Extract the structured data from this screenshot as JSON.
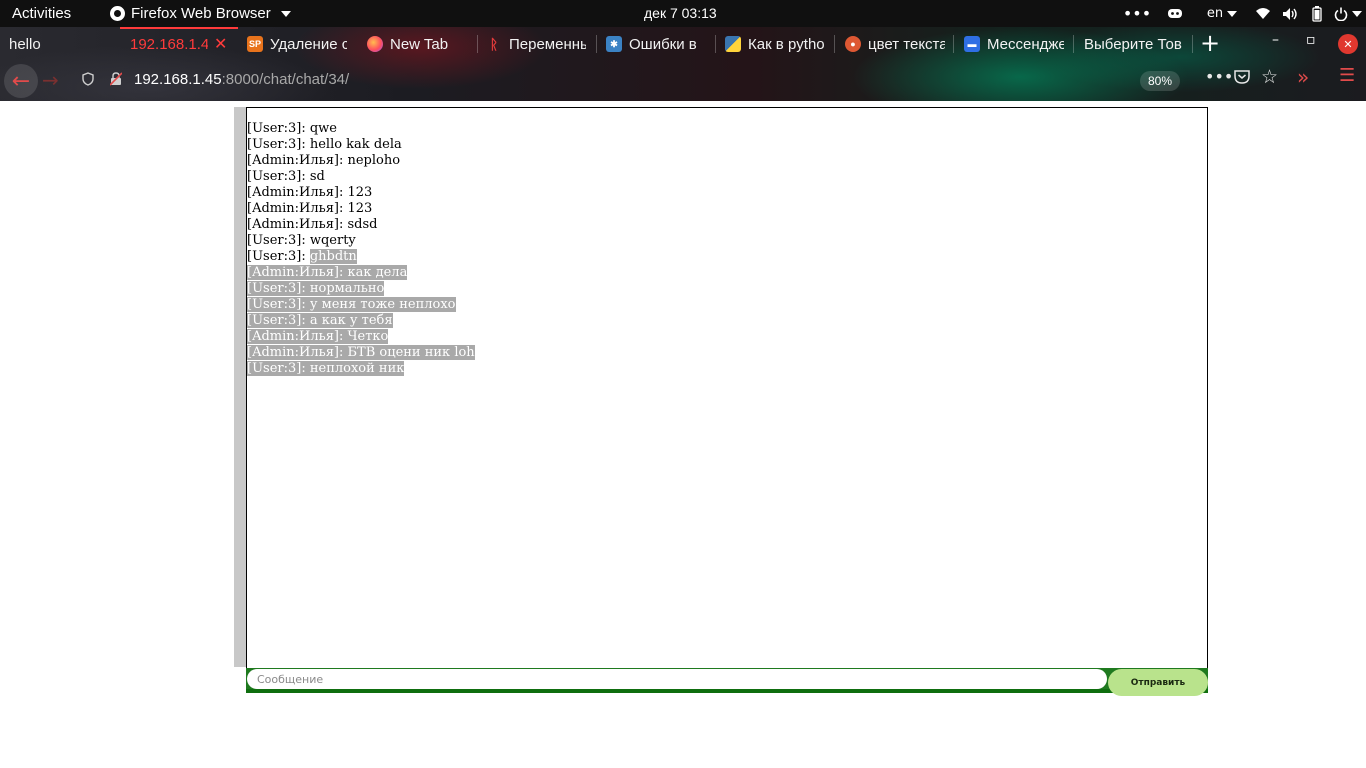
{
  "topbar": {
    "activities": "Activities",
    "app_name": "Firefox Web Browser",
    "clock": "дек 7  03:13",
    "language": "en",
    "icons": [
      "more-icon",
      "discord-icon",
      "wifi-icon",
      "volume-icon",
      "battery-icon",
      "power-icon"
    ]
  },
  "tabs": [
    {
      "label": "hello",
      "favicon": "none"
    },
    {
      "label": "192.168.1.4",
      "favicon": "none",
      "active": true
    },
    {
      "label": "Удаление с",
      "favicon": "sp-icon"
    },
    {
      "label": "New Tab",
      "favicon": "firefox-icon"
    },
    {
      "label": "Переменны",
      "favicon": "red-page-icon"
    },
    {
      "label": "Ошибки в",
      "favicon": "blue-square-icon"
    },
    {
      "label": "Как в pytho",
      "favicon": "python-icon"
    },
    {
      "label": "цвет текста",
      "favicon": "duckduckgo-icon"
    },
    {
      "label": "Мессендже",
      "favicon": "chat-icon"
    },
    {
      "label": "Выберите Тов",
      "favicon": "none"
    }
  ],
  "window_controls": {
    "new_tab": "+",
    "minimize": "–",
    "maximize": "▫",
    "close": "✕"
  },
  "navbar": {
    "url_host": "192.168.1.45",
    "url_rest": ":8000/chat/chat/34/",
    "zoom": "80%"
  },
  "chat": {
    "messages": [
      {
        "text": "[User:3]: qwe",
        "selected": ""
      },
      {
        "text": "[User:3]: hello kak dela",
        "selected": ""
      },
      {
        "text": "[Admin:Илья]: neploho",
        "selected": ""
      },
      {
        "text": "[User:3]: sd",
        "selected": ""
      },
      {
        "text": "[Admin:Илья]: 123",
        "selected": ""
      },
      {
        "text": "[Admin:Илья]: 123",
        "selected": ""
      },
      {
        "text": "[Admin:Илья]: sdsd",
        "selected": ""
      },
      {
        "text": "[User:3]: wqerty",
        "selected": ""
      },
      {
        "text": "[User:3]: ",
        "selected": "ghbdtn"
      },
      {
        "text": "",
        "selected": "[Admin:Илья]: как дела"
      },
      {
        "text": "",
        "selected": "[User:3]: нормально"
      },
      {
        "text": "",
        "selected": "[User:3]: у меня тоже неплохо"
      },
      {
        "text": "",
        "selected": "[User:3]: а как у тебя"
      },
      {
        "text": "",
        "selected": "[Admin:Илья]: Четко"
      },
      {
        "text": "",
        "selected": "[Admin:Илья]: БТВ оцени ник loh"
      },
      {
        "text": "",
        "selected": "[User:3]: неплохой ник"
      }
    ],
    "input_placeholder": "Сообщение",
    "input_value": "",
    "send_label": "Отправить"
  },
  "colors": {
    "accent_red": "#ff3b3b",
    "send_button": "#b9e38c",
    "input_bar": "#1f7a1f",
    "selection": "#a9a9a9"
  }
}
